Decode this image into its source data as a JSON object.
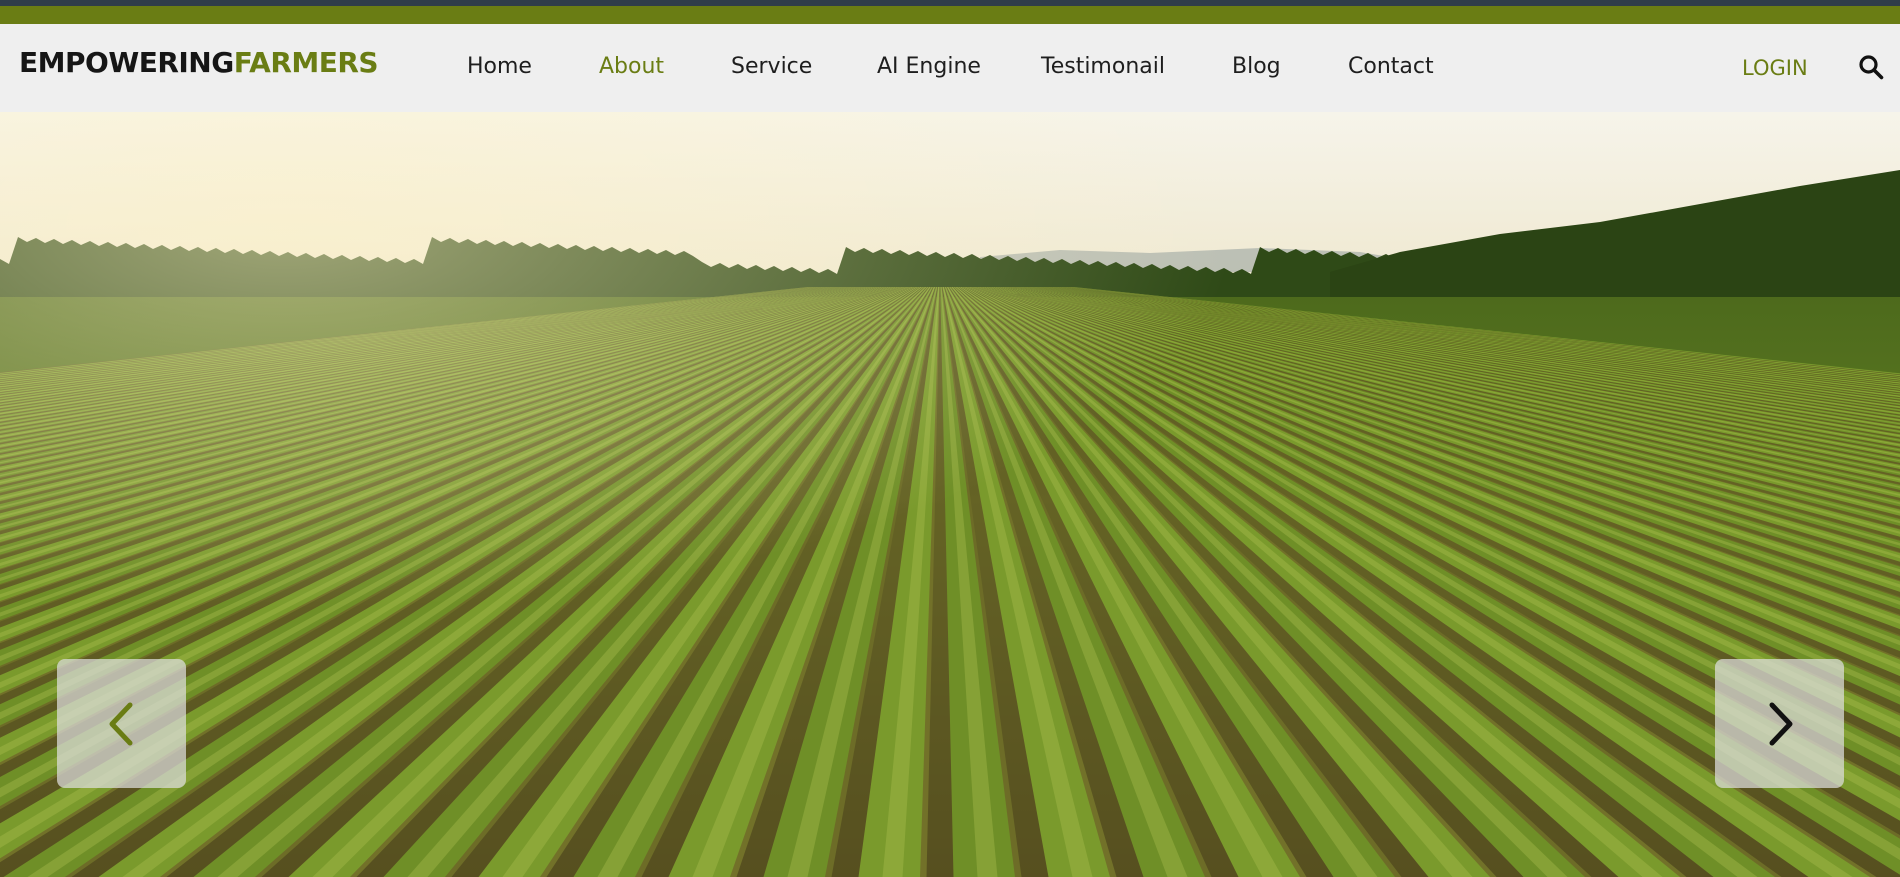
{
  "brand": {
    "part1": "EMPOWERING",
    "part2": "FARMERS"
  },
  "nav": {
    "items": [
      {
        "label": "Home"
      },
      {
        "label": "About",
        "active": true
      },
      {
        "label": "Service"
      },
      {
        "label": "AI Engine"
      },
      {
        "label": "Testimonail"
      },
      {
        "label": "Blog"
      },
      {
        "label": "Contact"
      }
    ],
    "login_label": "LOGIN",
    "search_icon": "search-icon"
  },
  "hero": {
    "image": "aerial view of green crop rows in farm field at sunset",
    "prev_icon": "chevron-left-icon",
    "next_icon": "chevron-right-icon"
  },
  "colors": {
    "accent": "#6a7d14",
    "top_bar": "#2f3d4a",
    "nav_bg": "#efefef",
    "text_dark": "#161616"
  }
}
